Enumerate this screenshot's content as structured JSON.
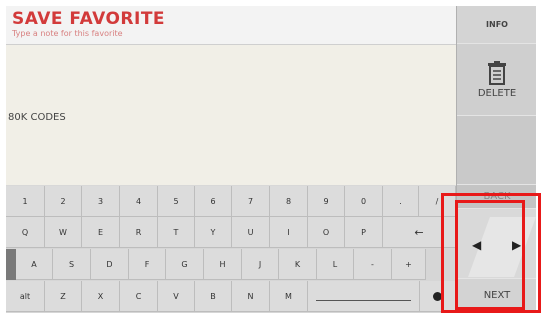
{
  "header": {
    "title": "SAVE FAVORITE",
    "subtitle": "Type a note for this favorite"
  },
  "note": {
    "text": "80K CODES"
  },
  "side": {
    "info": "INFO",
    "delete": "DELETE",
    "back": "BACK",
    "next": "NEXT"
  },
  "keyboard": {
    "row1": [
      "1",
      "2",
      "3",
      "4",
      "5",
      "6",
      "7",
      "8",
      "9",
      "0",
      ".",
      "/"
    ],
    "row2": [
      "Q",
      "W",
      "E",
      "R",
      "T",
      "Y",
      "U",
      "I",
      "O",
      "P",
      "←"
    ],
    "row3": [
      "A",
      "S",
      "D",
      "F",
      "G",
      "H",
      "J",
      "K",
      "L",
      "-",
      "+"
    ],
    "row4": [
      "alt",
      "Z",
      "X",
      "C",
      "V",
      "B",
      "N",
      "M"
    ]
  },
  "colors": {
    "title": "#d23a3a",
    "highlight": "#e81919"
  }
}
